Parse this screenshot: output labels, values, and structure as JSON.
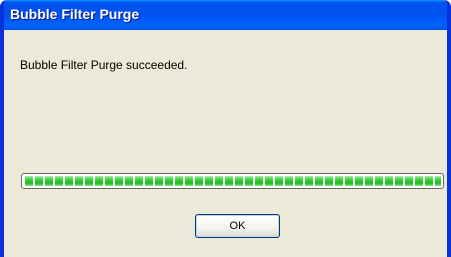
{
  "window": {
    "title": "Bubble Filter Purge"
  },
  "dialog": {
    "message": "Bubble Filter Purge succeeded.",
    "progress": 1.0,
    "ok_label": "OK"
  },
  "colors": {
    "title_bar": "#0053ee",
    "frame": "#0831d9",
    "dialog_background": "#ece9d8",
    "progress_fill": "#2fcc2f"
  }
}
